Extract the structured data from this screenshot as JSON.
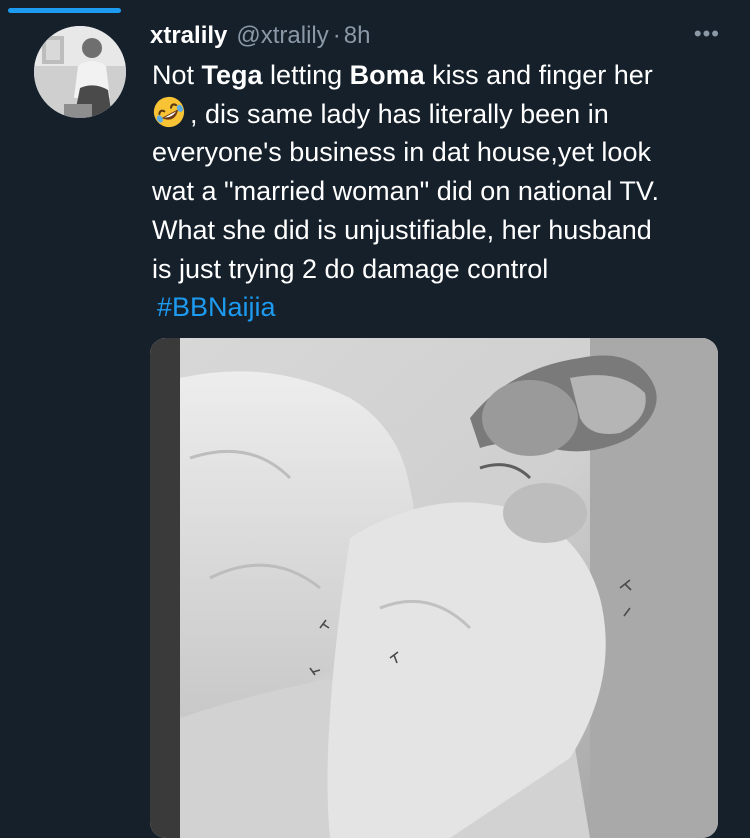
{
  "tweet": {
    "display_name": "xtralily",
    "handle": "@xtralily",
    "separator": "·",
    "time": "8h",
    "more_icon": "more-options-icon",
    "text": {
      "l1_a": "Not ",
      "l1_b": "Tega",
      "l1_c": " letting ",
      "l1_d": "Boma",
      "l1_e": " kiss and finger her",
      "emoji": "rolling-on-floor-laughing-emoji",
      "l2": ", dis same lady has literally been in",
      "l3": "everyone's business in dat house,yet look",
      "l4": "wat a \"married woman\" did on national TV.",
      "l5": "What she did is unjustifiable, her husband",
      "l6": "is just trying 2 do damage control",
      "hashtag": "#BBNaijia"
    },
    "media_icon": "photo"
  },
  "colors": {
    "background": "#15202b",
    "accent": "#1d9bf0",
    "secondary_text": "#8b98a5"
  }
}
